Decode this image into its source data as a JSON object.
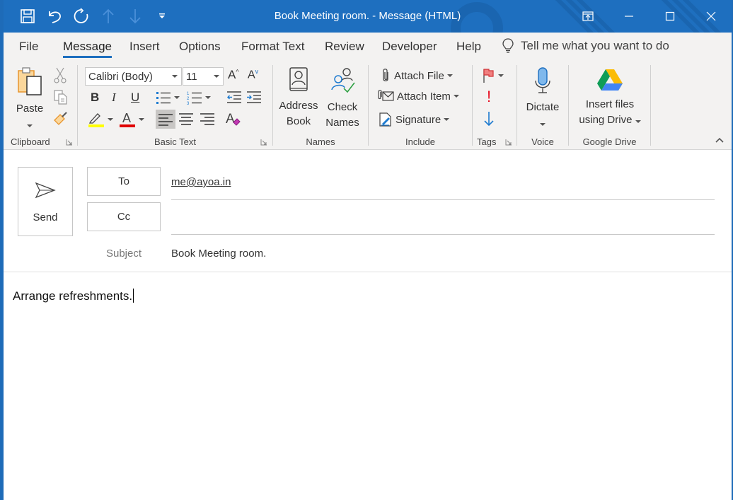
{
  "window": {
    "title": "Book Meeting room.  -  Message (HTML)",
    "controls": [
      "ribbon-display-options",
      "minimize",
      "maximize",
      "close"
    ]
  },
  "quick_access": [
    "save",
    "undo",
    "redo",
    "previous-item",
    "next-item",
    "customize"
  ],
  "tabs": [
    {
      "label": "File",
      "active": false
    },
    {
      "label": "Message",
      "active": true
    },
    {
      "label": "Insert",
      "active": false
    },
    {
      "label": "Options",
      "active": false
    },
    {
      "label": "Format Text",
      "active": false
    },
    {
      "label": "Review",
      "active": false
    },
    {
      "label": "Developer",
      "active": false
    },
    {
      "label": "Help",
      "active": false
    }
  ],
  "tell_me": {
    "placeholder": "Tell me what you want to do"
  },
  "ribbon": {
    "clipboard": {
      "label": "Clipboard",
      "paste": "Paste"
    },
    "basic_text": {
      "label": "Basic Text",
      "font": "Calibri (Body)",
      "size": "11",
      "highlight_color": "#ffff00",
      "font_color": "#e00000"
    },
    "names": {
      "label": "Names",
      "address_book": [
        "Address",
        "Book"
      ],
      "check_names": [
        "Check",
        "Names"
      ]
    },
    "include": {
      "label": "Include",
      "attach_file": "Attach File",
      "attach_item": "Attach Item",
      "signature": "Signature"
    },
    "tags": {
      "label": "Tags"
    },
    "voice": {
      "label": "Voice",
      "dictate": "Dictate"
    },
    "google_drive": {
      "label": "Google Drive",
      "insert_files": [
        "Insert files",
        "using Drive"
      ]
    }
  },
  "compose": {
    "send": "Send",
    "to_label": "To",
    "to_value": "me@ayoa.in",
    "cc_label": "Cc",
    "cc_value": "",
    "subject_label": "Subject",
    "subject_value": "Book Meeting room.",
    "body": "Arrange refreshments."
  },
  "colors": {
    "accent": "#1e6fbf",
    "ribbon_bg": "#f3f2f1"
  }
}
